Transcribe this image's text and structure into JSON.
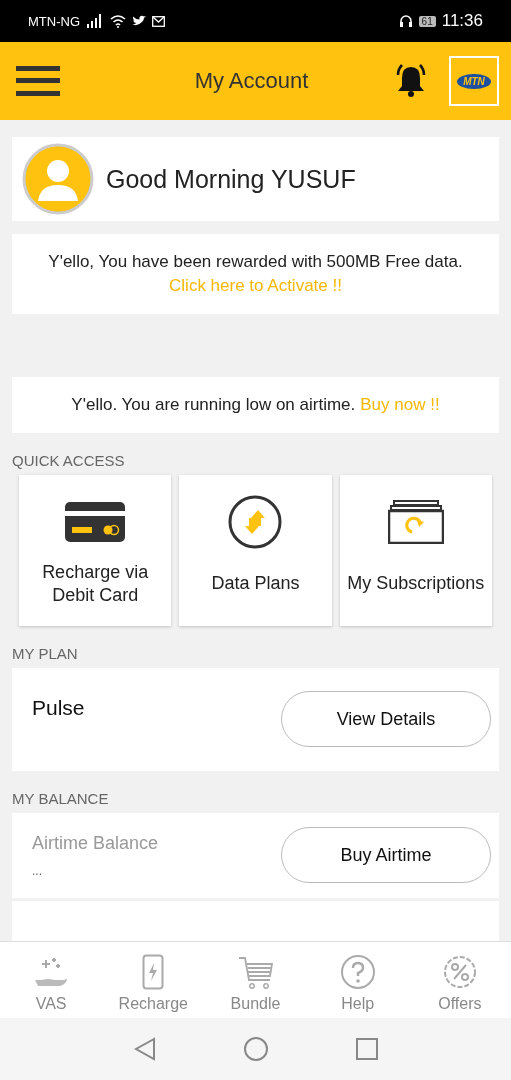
{
  "status_bar": {
    "carrier": "MTN-NG",
    "battery": "61",
    "time": "11:36"
  },
  "header": {
    "title": "My Account",
    "logo": "MTN"
  },
  "greeting": "Good Morning YUSUF",
  "reward": {
    "message": "Y'ello, You have been rewarded with 500MB Free data.",
    "link": "Click here to Activate !!"
  },
  "low_airtime": {
    "message": "Y'ello. You are running low on airtime.",
    "link": "Buy now !!"
  },
  "quick_access": {
    "heading": "QUICK ACCESS",
    "tiles": [
      {
        "label": "Recharge via Debit Card"
      },
      {
        "label": "Data Plans"
      },
      {
        "label": "My Subscriptions"
      }
    ]
  },
  "my_plan": {
    "heading": "MY PLAN",
    "plan": "Pulse",
    "button": "View Details"
  },
  "my_balance": {
    "heading": "MY BALANCE",
    "label": "Airtime Balance",
    "value": "...",
    "button": "Buy Airtime"
  },
  "bottom_nav": [
    {
      "label": "VAS"
    },
    {
      "label": "Recharge"
    },
    {
      "label": "Bundle"
    },
    {
      "label": "Help"
    },
    {
      "label": "Offers"
    }
  ]
}
